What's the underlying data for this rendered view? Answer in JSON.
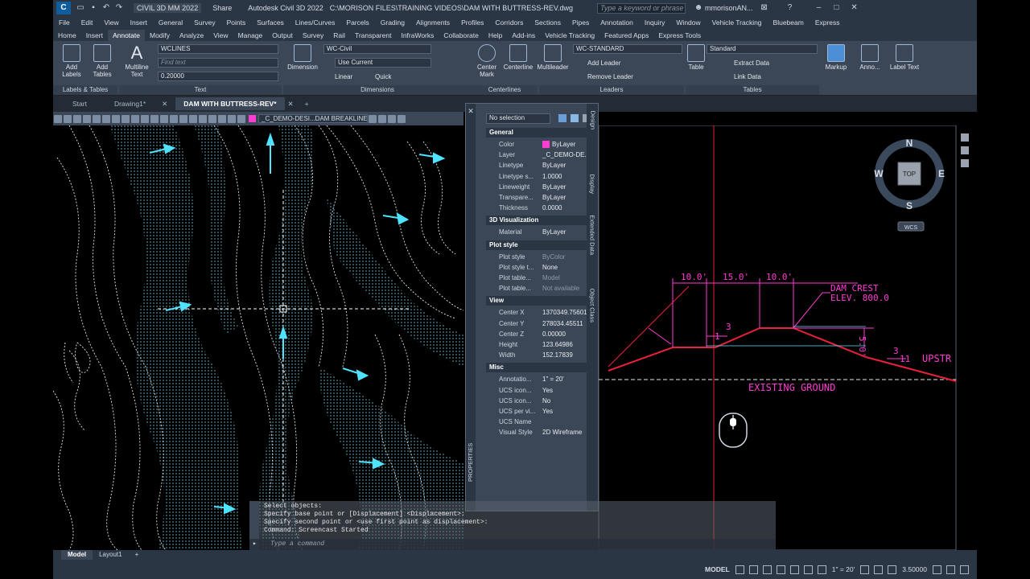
{
  "titlebar": {
    "workspace": "CIVIL 3D MM 2022",
    "share": "Share",
    "app_title": "Autodesk Civil 3D 2022",
    "file_path": "C:\\MORISON FILES\\TRAINING VIDEOS\\DAM WITH BUTTRESS-REV.dwg",
    "search_placeholder": "Type a keyword or phrase",
    "user": "mmorisonAN..."
  },
  "menubar": [
    "File",
    "Edit",
    "View",
    "Insert",
    "General",
    "Survey",
    "Points",
    "Surfaces",
    "Lines/Curves",
    "Parcels",
    "Grading",
    "Alignments",
    "Profiles",
    "Corridors",
    "Sections",
    "Pipes",
    "Annotation",
    "Inquiry",
    "Window",
    "Vehicle Tracking",
    "Bluebeam",
    "Express"
  ],
  "ribbon_tabs": [
    "Home",
    "Insert",
    "Annotate",
    "Modify",
    "Analyze",
    "View",
    "Manage",
    "Output",
    "Survey",
    "Rail",
    "Transparent",
    "InfraWorks",
    "Collaborate",
    "Help",
    "Add-ins",
    "Vehicle Tracking",
    "Featured Apps",
    "Express Tools"
  ],
  "ribbon": {
    "add_labels": "Add Labels",
    "add_tables": "Add Tables",
    "labels_tables": "Labels & Tables",
    "multiline_text": "Multiline Text",
    "text_style": "WCLINES",
    "find_text_placeholder": "Find text",
    "text_height": "0.20000",
    "text_panel": "Text",
    "dimension": "Dimension",
    "dim_style": "WC-Civil",
    "dim_layer": "Use Current",
    "linear": "Linear",
    "quick": "Quick",
    "dimensions_panel": "Dimensions",
    "center_mark": "Center Mark",
    "centerline": "Centerline",
    "centerlines_panel": "Centerlines",
    "multileader": "Multileader",
    "leader_style": "WC-STANDARD",
    "add_leader": "Add Leader",
    "remove_leader": "Remove Leader",
    "leaders_panel": "Leaders",
    "table": "Table",
    "table_style": "Standard",
    "extract_data": "Extract Data",
    "link_data": "Link Data",
    "tables_panel": "Tables",
    "markup": "Markup",
    "anno": "Anno...",
    "label_text": "Label Text"
  },
  "doc_tabs": [
    "Start",
    "Drawing1*",
    "DAM WITH BUTTRESS-REV*"
  ],
  "layer_dropdown": "_C_DEMO-DESI...DAM BREAKLINES",
  "properties": {
    "selection": "No selection",
    "sections": [
      {
        "title": "General",
        "rows": [
          [
            "Color",
            "ByLayer"
          ],
          [
            "Layer",
            "_C_DEMO-DE..."
          ],
          [
            "Linetype",
            "ByLayer"
          ],
          [
            "Linetype s...",
            "1.0000"
          ],
          [
            "Lineweight",
            "ByLayer"
          ],
          [
            "Transpare...",
            "ByLayer"
          ],
          [
            "Thickness",
            "0.0000"
          ]
        ]
      },
      {
        "title": "3D Visualization",
        "rows": [
          [
            "Material",
            "ByLayer"
          ]
        ]
      },
      {
        "title": "Plot style",
        "rows": [
          [
            "Plot style",
            "ByColor"
          ],
          [
            "Plot style t...",
            "None"
          ],
          [
            "Plot table...",
            "Model"
          ],
          [
            "Plot table...",
            "Not available"
          ]
        ]
      },
      {
        "title": "View",
        "rows": [
          [
            "Center X",
            "1370349.75601"
          ],
          [
            "Center Y",
            "278034.45511"
          ],
          [
            "Center Z",
            "0.00000"
          ],
          [
            "Height",
            "123.64986"
          ],
          [
            "Width",
            "152.17839"
          ]
        ]
      },
      {
        "title": "Misc",
        "rows": [
          [
            "Annotatio...",
            "1\" = 20'"
          ],
          [
            "UCS icon...",
            "Yes"
          ],
          [
            "UCS icon...",
            "No"
          ],
          [
            "UCS per vi...",
            "Yes"
          ],
          [
            "UCS Name",
            ""
          ],
          [
            "Visual Style",
            "2D Wireframe"
          ]
        ]
      }
    ],
    "vtabs": [
      "Design",
      "Display",
      "Extended Data",
      "Object Class"
    ],
    "side_label": "PROPERTIES"
  },
  "drawing": {
    "dims": [
      "10.0'",
      "15.0'",
      "10.0'"
    ],
    "crest_1": "DAM CREST",
    "crest_2": "ELEV. 800.0",
    "existing_ground": "EXISTING GROUND",
    "dim_5": "5.0'",
    "slope_1": "3",
    "slope_2": "1",
    "slope_3": "3",
    "slope_4": "11",
    "upstr": "UPSTR"
  },
  "viewcube": {
    "n": "N",
    "s": "S",
    "e": "E",
    "w": "W",
    "top": "TOP",
    "wcs": "WCS"
  },
  "command": {
    "lines": [
      "Select objects:",
      "Specify base point or [Displacement] <Displacement>:",
      "Specify second point or <use first point as displacement>:",
      "Command: Screencast Started"
    ],
    "placeholder": "Type a command"
  },
  "status": {
    "model_tab": "Model",
    "layout_tab": "Layout1",
    "model": "MODEL",
    "scale": "1\" = 20'",
    "value": "3.50000"
  },
  "colors": {
    "magenta": "#ff3cd2",
    "red": "#e8203a",
    "cyan": "#4fe3ff",
    "accent": "#0f5d9c"
  }
}
